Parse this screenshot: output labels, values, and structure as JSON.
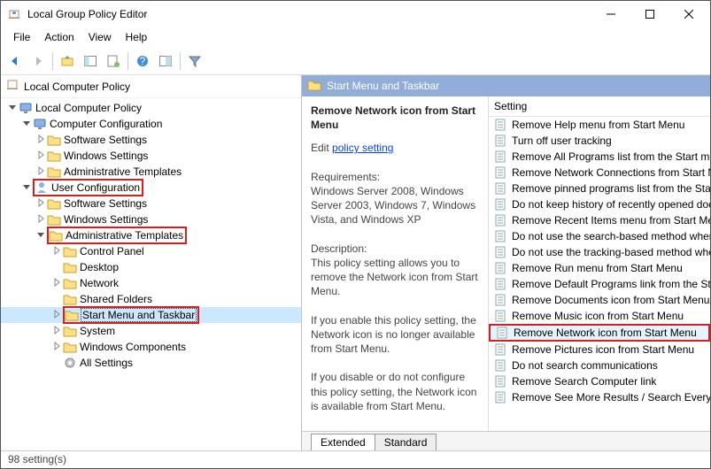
{
  "window": {
    "title": "Local Group Policy Editor"
  },
  "menu": {
    "file": "File",
    "action": "Action",
    "view": "View",
    "help": "Help"
  },
  "left_header": "Local Computer Policy",
  "tree": [
    {
      "ind": 0,
      "tw": "v",
      "icon": "monitor",
      "label": "Local Computer Policy",
      "box": ""
    },
    {
      "ind": 1,
      "tw": "v",
      "icon": "monitor",
      "label": "Computer Configuration",
      "box": ""
    },
    {
      "ind": 2,
      "tw": ">",
      "icon": "folder",
      "label": "Software Settings",
      "box": ""
    },
    {
      "ind": 2,
      "tw": ">",
      "icon": "folder",
      "label": "Windows Settings",
      "box": ""
    },
    {
      "ind": 2,
      "tw": ">",
      "icon": "folder",
      "label": "Administrative Templates",
      "box": ""
    },
    {
      "ind": 1,
      "tw": "v",
      "icon": "user",
      "label": "User Configuration",
      "box": "red"
    },
    {
      "ind": 2,
      "tw": ">",
      "icon": "folder",
      "label": "Software Settings",
      "box": ""
    },
    {
      "ind": 2,
      "tw": ">",
      "icon": "folder",
      "label": "Windows Settings",
      "box": ""
    },
    {
      "ind": 2,
      "tw": "v",
      "icon": "folder",
      "label": "Administrative Templates",
      "box": "red"
    },
    {
      "ind": 3,
      "tw": ">",
      "icon": "folder",
      "label": "Control Panel",
      "box": ""
    },
    {
      "ind": 3,
      "tw": "",
      "icon": "folder",
      "label": "Desktop",
      "box": ""
    },
    {
      "ind": 3,
      "tw": ">",
      "icon": "folder",
      "label": "Network",
      "box": ""
    },
    {
      "ind": 3,
      "tw": "",
      "icon": "folder",
      "label": "Shared Folders",
      "box": ""
    },
    {
      "ind": 3,
      "tw": ">",
      "icon": "folder",
      "label": "Start Menu and Taskbar",
      "box": "red",
      "sel": true
    },
    {
      "ind": 3,
      "tw": ">",
      "icon": "folder",
      "label": "System",
      "box": ""
    },
    {
      "ind": 3,
      "tw": ">",
      "icon": "folder",
      "label": "Windows Components",
      "box": ""
    },
    {
      "ind": 3,
      "tw": "",
      "icon": "gear",
      "label": "All Settings",
      "box": ""
    }
  ],
  "right_header": "Start Menu and Taskbar",
  "detail": {
    "name": "Remove Network icon from Start Menu",
    "edit_prefix": "Edit ",
    "edit_link": "policy setting",
    "req_label": "Requirements:",
    "req_text": "Windows Server 2008, Windows Server 2003, Windows 7, Windows Vista, and Windows XP",
    "desc_label": "Description:",
    "desc1": "This policy setting allows you to remove the Network icon from Start Menu.",
    "desc2": "If you enable this policy setting, the Network icon is no longer available from Start Menu.",
    "desc3": "If you disable or do not configure this policy setting, the Network icon is available from Start Menu."
  },
  "list_head": "Setting",
  "settings": [
    {
      "label": "Remove Help menu from Start Menu"
    },
    {
      "label": "Turn off user tracking"
    },
    {
      "label": "Remove All Programs list from the Start me"
    },
    {
      "label": "Remove Network Connections from Start M"
    },
    {
      "label": "Remove pinned programs list from the Sta"
    },
    {
      "label": "Do not keep history of recently opened doc"
    },
    {
      "label": "Remove Recent Items menu from Start Men"
    },
    {
      "label": "Do not use the search-based method when"
    },
    {
      "label": "Do not use the tracking-based method whe"
    },
    {
      "label": "Remove Run menu from Start Menu"
    },
    {
      "label": "Remove Default Programs link from the Sta"
    },
    {
      "label": "Remove Documents icon from Start Menu"
    },
    {
      "label": "Remove Music icon from Start Menu"
    },
    {
      "label": "Remove Network icon from Start Menu",
      "box": "red",
      "hl": true
    },
    {
      "label": "Remove Pictures icon from Start Menu"
    },
    {
      "label": "Do not search communications"
    },
    {
      "label": "Remove Search Computer link"
    },
    {
      "label": "Remove See More Results / Search Everywh"
    }
  ],
  "tabs": {
    "extended": "Extended",
    "standard": "Standard"
  },
  "status": "98 setting(s)"
}
